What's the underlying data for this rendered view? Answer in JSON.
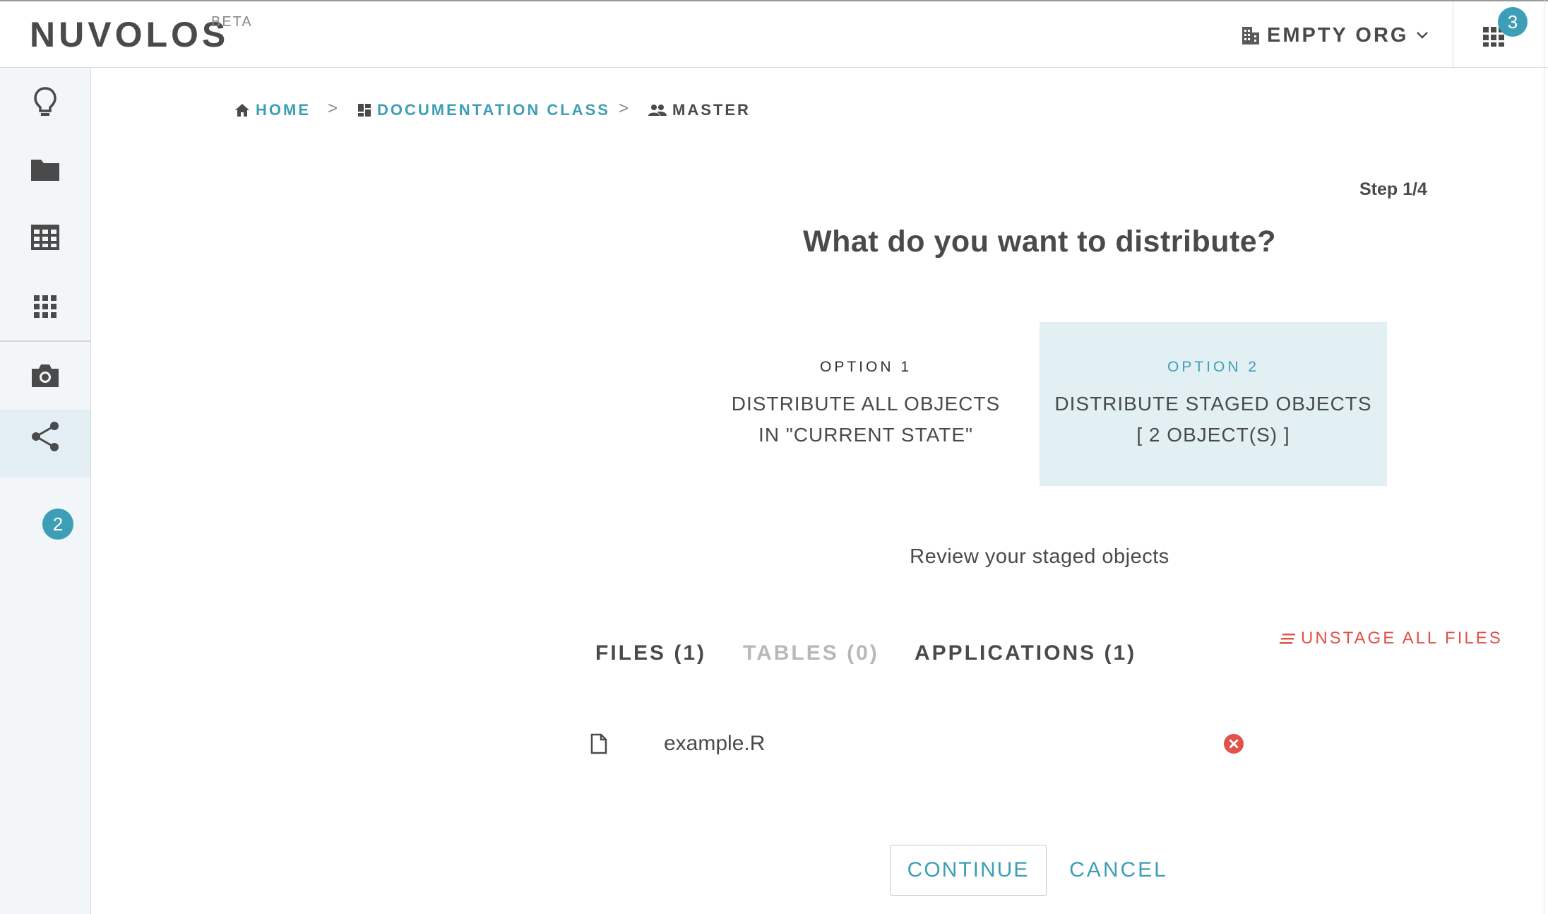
{
  "app": {
    "logo": "NUVOLOS",
    "logo_badge": "BETA"
  },
  "header": {
    "org_name": "EMPTY ORG",
    "apps_badge_count": "3"
  },
  "sidebar": {
    "items": [
      {
        "icon": "lightbulb-icon"
      },
      {
        "icon": "folder-icon"
      },
      {
        "icon": "table-icon"
      },
      {
        "icon": "apps-grid-icon"
      },
      {
        "icon": "camera-icon"
      },
      {
        "icon": "share-icon",
        "badge": "2",
        "active": true
      }
    ]
  },
  "breadcrumb": {
    "home": "HOME",
    "separator": ">",
    "space": "DOCUMENTATION CLASS",
    "instance": "MASTER"
  },
  "wizard": {
    "step": "Step 1/4",
    "title": "What do you want to distribute?",
    "option1": {
      "label": "OPTION 1",
      "line1": "DISTRIBUTE ALL OBJECTS",
      "line2": "IN \"CURRENT STATE\""
    },
    "option2": {
      "label": "OPTION 2",
      "line1": "DISTRIBUTE STAGED OBJECTS",
      "line2": "[ 2 OBJECT(S) ]",
      "selected": true
    },
    "review_text": "Review your staged objects",
    "tabs": {
      "files": "FILES (1)",
      "tables": "TABLES (0)",
      "applications": "APPLICATIONS (1)"
    },
    "unstage_all": "UNSTAGE ALL FILES",
    "files": [
      {
        "name": "example.R"
      }
    ],
    "continue_label": "CONTINUE",
    "cancel_label": "CANCEL"
  },
  "colors": {
    "accent": "#3d9fb7",
    "danger": "#e0524a",
    "selected_bg": "#e3f0f3",
    "text": "#4a4a4a"
  }
}
